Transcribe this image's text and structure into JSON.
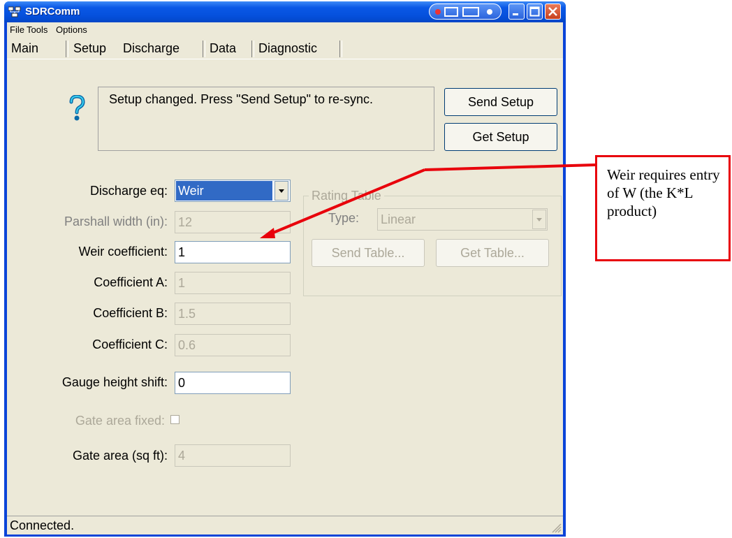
{
  "window": {
    "title": "SDRComm"
  },
  "menu": {
    "items": [
      "File",
      "Tools",
      "Options"
    ]
  },
  "tabs": [
    {
      "label": "Main",
      "active": false
    },
    {
      "label": "Setup",
      "active": false
    },
    {
      "label": "Discharge",
      "active": true
    },
    {
      "label": "Data",
      "active": false
    },
    {
      "label": "Diagnostic",
      "active": false
    }
  ],
  "message": {
    "text": "Setup changed. Press \"Send Setup\" to re-sync."
  },
  "buttons": {
    "send_setup": "Send Setup",
    "get_setup": "Get Setup",
    "send_table": "Send Table...",
    "get_table": "Get Table..."
  },
  "discharge_eq": {
    "label": "Discharge eq:",
    "value": "Weir"
  },
  "rating_table": {
    "title": "Rating Table",
    "type_label": "Type:",
    "type_value": "Linear"
  },
  "fields": {
    "parshall_width": {
      "label": "Parshall width (in):",
      "value": "12"
    },
    "weir_coefficient": {
      "label": "Weir coefficient:",
      "value": "1"
    },
    "coefficient_a": {
      "label": "Coefficient A:",
      "value": "1"
    },
    "coefficient_b": {
      "label": "Coefficient B:",
      "value": "1.5"
    },
    "coefficient_c": {
      "label": "Coefficient C:",
      "value": "0.6"
    },
    "gauge_height_shift": {
      "label": "Gauge height shift:",
      "value": "0"
    },
    "gate_area_fixed": {
      "label": "Gate area fixed:",
      "checked": false
    },
    "gate_area": {
      "label": "Gate area (sq ft):",
      "value": "4"
    }
  },
  "status": {
    "text": "Connected."
  },
  "callout": {
    "text": "Weir requires entry of W (the  K*L product)"
  },
  "colors": {
    "annotation": "#e8000b",
    "titlebar": "#0550dc",
    "selection": "#316ac5"
  }
}
